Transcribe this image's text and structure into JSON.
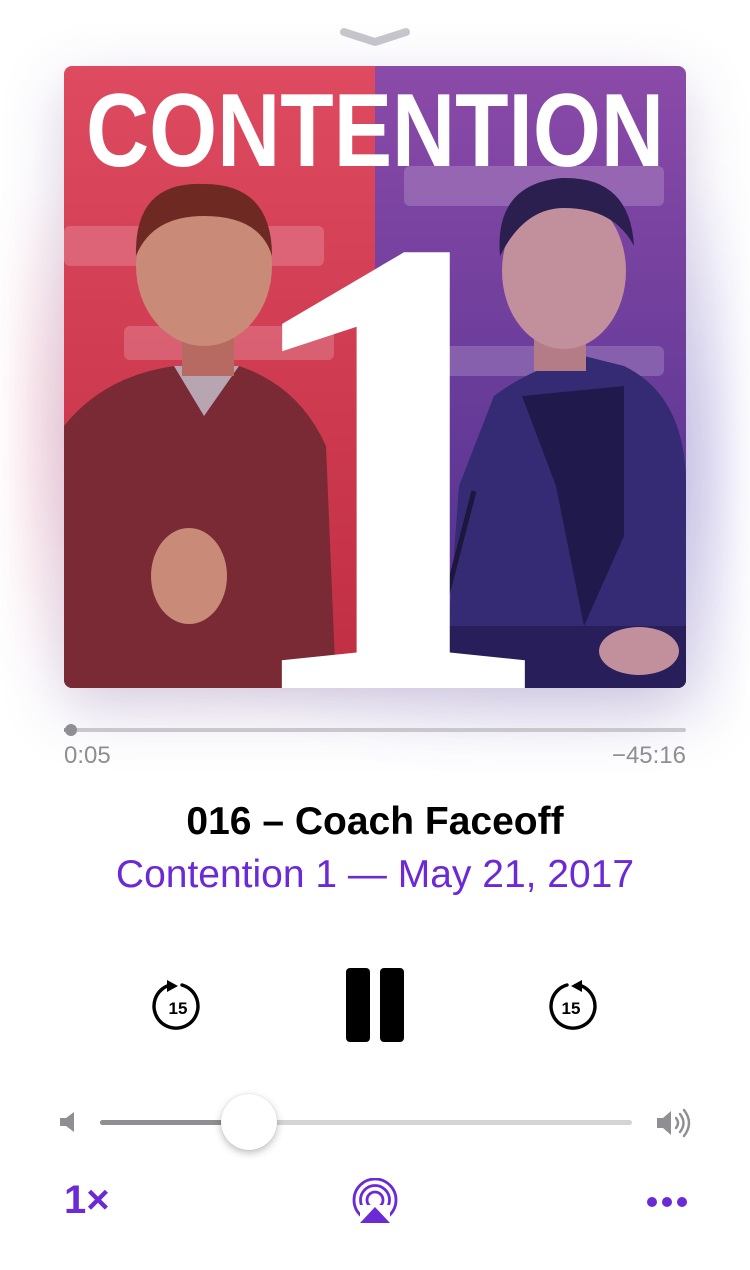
{
  "artwork": {
    "show_title": "CONTENTION",
    "episode_number": "1",
    "left_color": "#d2334f",
    "right_color": "#7d3aa4"
  },
  "progress": {
    "elapsed": "0:05",
    "remaining": "−45:16",
    "fraction": 0.002
  },
  "episode": {
    "title": "016 – Coach Faceoff",
    "subtitle": "Contention 1 — May 21, 2017"
  },
  "controls": {
    "skip_back_seconds": "15",
    "skip_forward_seconds": "15",
    "state": "playing"
  },
  "volume": {
    "level": 0.28
  },
  "footer": {
    "speed_label": "1×"
  },
  "icons": {
    "grabber": "chevron-down-icon",
    "skip_back": "rewind-15-icon",
    "pause": "pause-icon",
    "skip_forward": "forward-15-icon",
    "volume_low": "speaker-low-icon",
    "volume_high": "speaker-high-icon",
    "airplay": "airplay-audio-icon",
    "more": "more-dots-icon"
  },
  "colors": {
    "accent": "#6b2ad6",
    "track": "#c8c7cc",
    "secondary_text": "#8e8e93"
  }
}
